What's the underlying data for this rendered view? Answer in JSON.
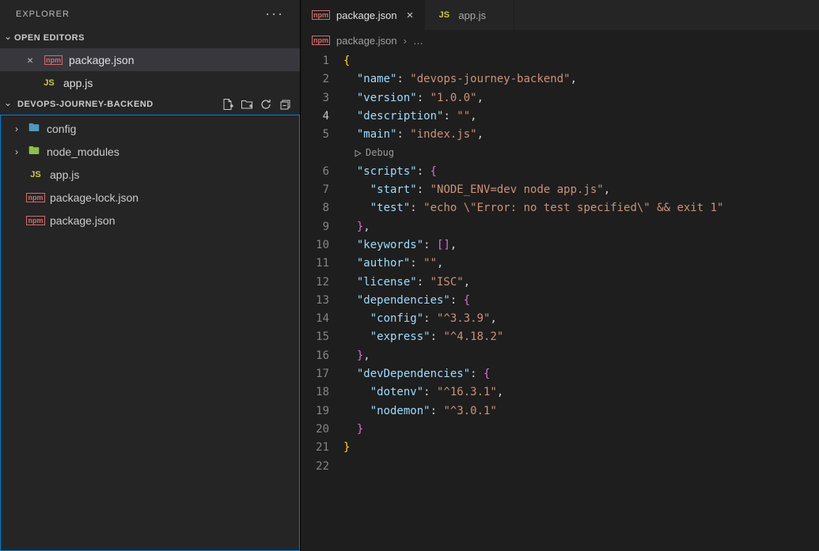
{
  "sidebar": {
    "title": "EXPLORER",
    "open_editors": {
      "label": "OPEN EDITORS",
      "items": [
        {
          "name": "package.json",
          "icon": "npm",
          "active": true
        },
        {
          "name": "app.js",
          "icon": "js",
          "active": false
        }
      ]
    },
    "project": {
      "name": "DEVOPS-JOURNEY-BACKEND",
      "children": [
        {
          "type": "folder",
          "name": "config",
          "icon": "cfg"
        },
        {
          "type": "folder",
          "name": "node_modules",
          "icon": "nm"
        },
        {
          "type": "file",
          "name": "app.js",
          "icon": "js"
        },
        {
          "type": "file",
          "name": "package-lock.json",
          "icon": "npm"
        },
        {
          "type": "file",
          "name": "package.json",
          "icon": "npm"
        }
      ]
    }
  },
  "tabs": [
    {
      "name": "package.json",
      "icon": "npm",
      "active": true
    },
    {
      "name": "app.js",
      "icon": "js",
      "active": false
    }
  ],
  "breadcrumbs": [
    "package.json"
  ],
  "active_line": 4,
  "codelens": "Debug",
  "file_content": {
    "name": "devops-journey-backend",
    "version": "1.0.0",
    "description": "",
    "main": "index.js",
    "scripts": {
      "start": "NODE_ENV=dev node app.js",
      "test": "echo \\\"Error: no test specified\\\" && exit 1"
    },
    "keywords": [],
    "author": "",
    "license": "ISC",
    "dependencies": {
      "config": "^3.3.9",
      "express": "^4.18.2"
    },
    "devDependencies": {
      "dotenv": "^16.3.1",
      "nodemon": "^3.0.1"
    }
  },
  "code_lines": [
    [
      [
        "brace",
        "{"
      ]
    ],
    [
      [
        "s",
        "  "
      ],
      [
        "key",
        "\"name\""
      ],
      [
        "punc",
        ": "
      ],
      [
        "str",
        "\"devops-journey-backend\""
      ],
      [
        "punc",
        ","
      ]
    ],
    [
      [
        "s",
        "  "
      ],
      [
        "key",
        "\"version\""
      ],
      [
        "punc",
        ": "
      ],
      [
        "str",
        "\"1.0.0\""
      ],
      [
        "punc",
        ","
      ]
    ],
    [
      [
        "s",
        "  "
      ],
      [
        "key",
        "\"description\""
      ],
      [
        "punc",
        ": "
      ],
      [
        "str",
        "\"\""
      ],
      [
        "punc",
        ","
      ]
    ],
    [
      [
        "s",
        "  "
      ],
      [
        "key",
        "\"main\""
      ],
      [
        "punc",
        ": "
      ],
      [
        "str",
        "\"index.js\""
      ],
      [
        "punc",
        ","
      ]
    ],
    [
      [
        "s",
        "  "
      ],
      [
        "key",
        "\"scripts\""
      ],
      [
        "punc",
        ": "
      ],
      [
        "brace2",
        "{"
      ]
    ],
    [
      [
        "s",
        "    "
      ],
      [
        "key",
        "\"start\""
      ],
      [
        "punc",
        ": "
      ],
      [
        "str",
        "\"NODE_ENV=dev node app.js\""
      ],
      [
        "punc",
        ","
      ]
    ],
    [
      [
        "s",
        "    "
      ],
      [
        "key",
        "\"test\""
      ],
      [
        "punc",
        ": "
      ],
      [
        "str",
        "\"echo \\\\\"Error: no test specified\\\\\" && exit 1\""
      ]
    ],
    [
      [
        "s",
        "  "
      ],
      [
        "brace2",
        "}"
      ],
      [
        "punc",
        ","
      ]
    ],
    [
      [
        "s",
        "  "
      ],
      [
        "key",
        "\"keywords\""
      ],
      [
        "punc",
        ": "
      ],
      [
        "brack",
        "[]"
      ],
      [
        "punc",
        ","
      ]
    ],
    [
      [
        "s",
        "  "
      ],
      [
        "key",
        "\"author\""
      ],
      [
        "punc",
        ": "
      ],
      [
        "str",
        "\"\""
      ],
      [
        "punc",
        ","
      ]
    ],
    [
      [
        "s",
        "  "
      ],
      [
        "key",
        "\"license\""
      ],
      [
        "punc",
        ": "
      ],
      [
        "str",
        "\"ISC\""
      ],
      [
        "punc",
        ","
      ]
    ],
    [
      [
        "s",
        "  "
      ],
      [
        "key",
        "\"dependencies\""
      ],
      [
        "punc",
        ": "
      ],
      [
        "brace2",
        "{"
      ]
    ],
    [
      [
        "s",
        "    "
      ],
      [
        "key",
        "\"config\""
      ],
      [
        "punc",
        ": "
      ],
      [
        "str",
        "\"^3.3.9\""
      ],
      [
        "punc",
        ","
      ]
    ],
    [
      [
        "s",
        "    "
      ],
      [
        "key",
        "\"express\""
      ],
      [
        "punc",
        ": "
      ],
      [
        "str",
        "\"^4.18.2\""
      ]
    ],
    [
      [
        "s",
        "  "
      ],
      [
        "brace2",
        "}"
      ],
      [
        "punc",
        ","
      ]
    ],
    [
      [
        "s",
        "  "
      ],
      [
        "key",
        "\"devDependencies\""
      ],
      [
        "punc",
        ": "
      ],
      [
        "brace2",
        "{"
      ]
    ],
    [
      [
        "s",
        "    "
      ],
      [
        "key",
        "\"dotenv\""
      ],
      [
        "punc",
        ": "
      ],
      [
        "str",
        "\"^16.3.1\""
      ],
      [
        "punc",
        ","
      ]
    ],
    [
      [
        "s",
        "    "
      ],
      [
        "key",
        "\"nodemon\""
      ],
      [
        "punc",
        ": "
      ],
      [
        "str",
        "\"^3.0.1\""
      ]
    ],
    [
      [
        "s",
        "  "
      ],
      [
        "brace2",
        "}"
      ]
    ],
    [
      [
        "brace",
        "}"
      ]
    ],
    [
      [
        "s",
        ""
      ]
    ]
  ]
}
